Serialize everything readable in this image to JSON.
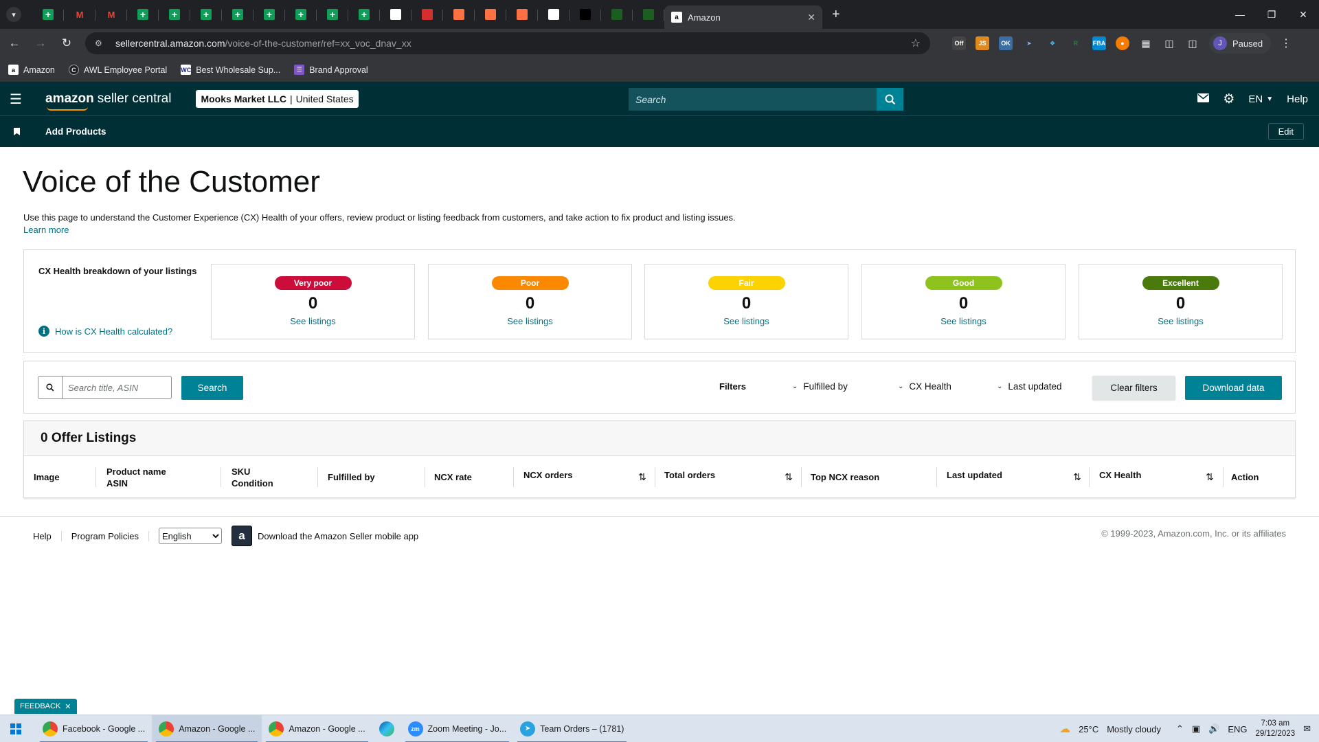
{
  "browser": {
    "active_tab_title": "Amazon",
    "pinned_tabs": [
      {
        "icon": "sheets-icon",
        "color": "#0f9d58"
      },
      {
        "icon": "gmail-icon",
        "color": "#ea4335"
      },
      {
        "icon": "gmail-icon",
        "color": "#ea4335"
      },
      {
        "icon": "sheets-icon",
        "color": "#0f9d58"
      },
      {
        "icon": "sheets-icon",
        "color": "#0f9d58"
      },
      {
        "icon": "sheets-icon",
        "color": "#0f9d58"
      },
      {
        "icon": "sheets-icon",
        "color": "#0f9d58"
      },
      {
        "icon": "sheets-icon",
        "color": "#0f9d58"
      },
      {
        "icon": "sheets-icon",
        "color": "#0f9d58"
      },
      {
        "icon": "sheets-icon",
        "color": "#0f9d58"
      },
      {
        "icon": "sheets-icon",
        "color": "#0f9d58"
      },
      {
        "icon": "app-icon",
        "color": "#ffffff"
      },
      {
        "icon": "app-icon",
        "color": "#d32f2f"
      },
      {
        "icon": "app-icon",
        "color": "#ff7043"
      },
      {
        "icon": "app-icon",
        "color": "#ff7043"
      },
      {
        "icon": "app-icon",
        "color": "#ff7043"
      },
      {
        "icon": "app-icon",
        "color": "#ffffff"
      },
      {
        "icon": "app-icon",
        "color": "#000000"
      },
      {
        "icon": "app-icon",
        "color": "#1b5e20"
      },
      {
        "icon": "app-icon",
        "color": "#1b5e20"
      }
    ],
    "url_host": "sellercentral.amazon.com",
    "url_path": "/voice-of-the-customer/ref=xx_voc_dnav_xx",
    "profile_initial": "J",
    "profile_status": "Paused",
    "bookmarks": [
      {
        "label": "Amazon",
        "icon": "amazon-icon"
      },
      {
        "label": "AWL Employee Portal",
        "icon": "portal-icon"
      },
      {
        "label": "Best Wholesale Sup...",
        "icon": "wc-icon"
      },
      {
        "label": "Brand Approval",
        "icon": "list-icon"
      }
    ]
  },
  "header": {
    "logo_bold": "amazon",
    "logo_rest": "seller central",
    "store_name": "Mooks Market LLC",
    "store_region": "United States",
    "search_placeholder": "Search",
    "language": "EN",
    "help": "Help"
  },
  "subnav": {
    "add_products": "Add Products",
    "edit": "Edit"
  },
  "page": {
    "title": "Voice of the Customer",
    "description": "Use this page to understand the Customer Experience (CX) Health of your offers, review product or listing feedback from customers, and take action to fix product and listing issues.",
    "learn_more": "Learn more"
  },
  "cx_health": {
    "heading": "CX Health breakdown of your listings",
    "help_link": "How is CX Health calculated?",
    "cards": [
      {
        "label": "Very poor",
        "count": "0",
        "link": "See listings",
        "color": "#cc0c39"
      },
      {
        "label": "Poor",
        "count": "0",
        "link": "See listings",
        "color": "#fa8900"
      },
      {
        "label": "Fair",
        "count": "0",
        "link": "See listings",
        "color": "#fcd200"
      },
      {
        "label": "Good",
        "count": "0",
        "link": "See listings",
        "color": "#8ec31e"
      },
      {
        "label": "Excellent",
        "count": "0",
        "link": "See listings",
        "color": "#4a7a0b"
      }
    ]
  },
  "search": {
    "placeholder": "Search title, ASIN",
    "button": "Search",
    "filters_label": "Filters",
    "dropdowns": [
      "Fulfilled by",
      "CX Health",
      "Last updated"
    ],
    "clear_filters": "Clear filters",
    "download": "Download data"
  },
  "listings": {
    "heading": "0 Offer Listings",
    "columns": [
      {
        "line1": "Image",
        "line2": ""
      },
      {
        "line1": "Product name",
        "line2": "ASIN"
      },
      {
        "line1": "SKU",
        "line2": "Condition"
      },
      {
        "line1": "Fulfilled by",
        "line2": ""
      },
      {
        "line1": "NCX rate",
        "line2": ""
      },
      {
        "line1": "NCX orders",
        "line2": ""
      },
      {
        "line1": "Total orders",
        "line2": ""
      },
      {
        "line1": "Top NCX reason",
        "line2": ""
      },
      {
        "line1": "Last updated",
        "line2": ""
      },
      {
        "line1": "CX Health",
        "line2": ""
      },
      {
        "line1": "Action",
        "line2": ""
      }
    ]
  },
  "footer": {
    "help": "Help",
    "program_policies": "Program Policies",
    "language_selected": "English",
    "app_link": "Download the Amazon Seller mobile app",
    "copyright": "© 1999-2023, Amazon.com, Inc. or its affiliates"
  },
  "feedback": "FEEDBACK",
  "taskbar": {
    "items": [
      {
        "label": "Facebook - Google ...",
        "icon": "chrome-icon"
      },
      {
        "label": "Amazon - Google ...",
        "icon": "chrome-icon"
      },
      {
        "label": "Amazon - Google ...",
        "icon": "chrome-icon"
      },
      {
        "label": "",
        "icon": "edge-icon"
      },
      {
        "label": "Zoom Meeting - Jo...",
        "icon": "zoom-icon"
      },
      {
        "label": "Team Orders – (1781)",
        "icon": "telegram-icon"
      }
    ],
    "weather_temp": "25°C",
    "weather_text": "Mostly cloudy",
    "lang": "ENG",
    "time": "7:03 am",
    "date": "29/12/2023"
  }
}
